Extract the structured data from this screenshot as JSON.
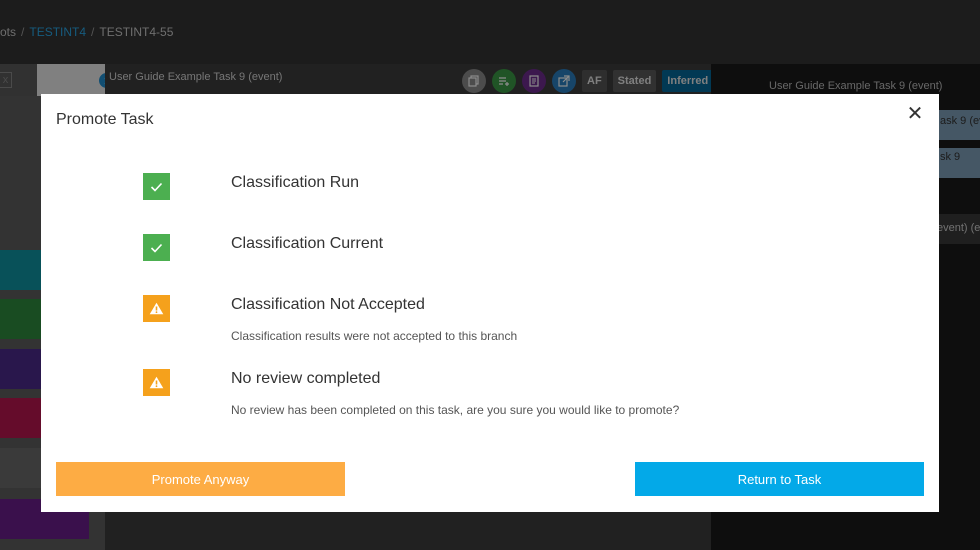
{
  "breadcrumb": {
    "items": [
      "ots",
      "TESTINT4",
      "TESTINT4-55"
    ],
    "separator": "/"
  },
  "left_panel": {
    "tab_x_icon": "x-icon",
    "tab_info_icon": "info-icon",
    "info_glyph": "i",
    "x_glyph": "x",
    "stripe_colors": [
      "#0f94a3",
      "#2e8a3e",
      "#4b2a8a",
      "#b8174f",
      "#6a6a6a",
      "#6a1e8a"
    ]
  },
  "center_panel": {
    "title": "User Guide Example Task 9 (event)",
    "tools": {
      "af_label": "AF",
      "stated_label": "Stated",
      "inferred_label": "Inferred"
    }
  },
  "right_panel": {
    "title": "User Guide Example Task 9 (event)",
    "row1": "ask 9 (eve",
    "row2": "sk 9",
    "row3": "event) (ev"
  },
  "modal": {
    "title": "Promote Task",
    "close_glyph": "✕",
    "checks": [
      {
        "label": "Classification Run",
        "status": "ok",
        "detail": ""
      },
      {
        "label": "Classification Current",
        "status": "ok",
        "detail": ""
      },
      {
        "label": "Classification Not Accepted",
        "status": "warning",
        "detail": "Classification results were not accepted to this branch"
      },
      {
        "label": "No review completed",
        "status": "warning",
        "detail": "No review has been completed on this task, are you sure you would like to promote?"
      }
    ],
    "promote_label": "Promote Anyway",
    "return_label": "Return to Task"
  },
  "colors": {
    "ok": "#4caf50",
    "warning": "#f5a11c",
    "promote_button": "#fdac44",
    "return_button": "#03a9e8",
    "breadcrumb_link": "#29a6e6"
  }
}
